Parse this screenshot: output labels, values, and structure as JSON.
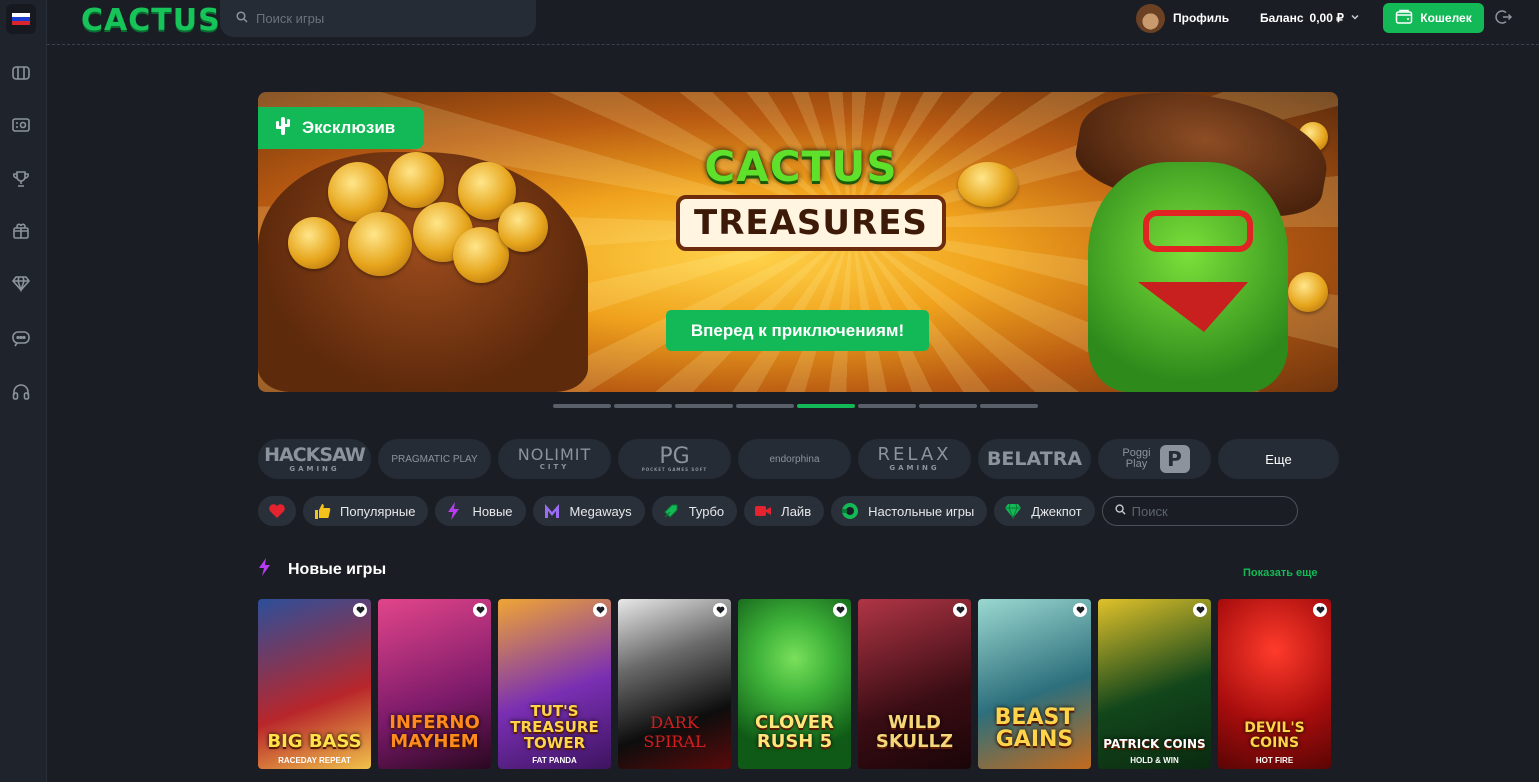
{
  "header": {
    "logo": "CACTUS",
    "search_placeholder": "Поиск игры",
    "profile_label": "Профиль",
    "balance_label": "Баланс",
    "balance_value": "0,00 ₽",
    "wallet_label": "Кошелек"
  },
  "sidebar": {
    "language": "ru",
    "items": [
      "slots-icon",
      "live-games-icon",
      "tournaments-icon",
      "gift-icon",
      "vip-diamond-icon",
      "chat-icon",
      "support-headset-icon"
    ]
  },
  "banner": {
    "badge": "Эксклюзив",
    "game_title_line1": "CACTUS",
    "game_title_line2": "TREASURES",
    "cta": "Вперед к приключениям!",
    "slides_total": 8,
    "active_slide": 5
  },
  "providers": [
    {
      "name": "HACKSAW",
      "sub": "GAMING"
    },
    {
      "name": "PRAGMATIC PLAY",
      "sub": ""
    },
    {
      "name": "NOLIMIT",
      "sub": "CITY"
    },
    {
      "name": "PG",
      "sub": "POCKET GAMES SOFT"
    },
    {
      "name": "endorphina",
      "sub": ""
    },
    {
      "name": "RELAX",
      "sub": "GAMING"
    },
    {
      "name": "BELATRA",
      "sub": ""
    },
    {
      "name": "Poggi Play",
      "sub": ""
    }
  ],
  "providers_more": "Еще",
  "categories": [
    {
      "label": "",
      "icon": "heart-icon",
      "color": "#e5232f"
    },
    {
      "label": "Популярные",
      "icon": "thumbs-up-icon",
      "color": "#f3c21b"
    },
    {
      "label": "Новые",
      "icon": "lightning-icon",
      "color": "#b83cf0"
    },
    {
      "label": "Megaways",
      "icon": "megaways-icon",
      "color": "#9a6cf5"
    },
    {
      "label": "Турбо",
      "icon": "turbo-icon",
      "color": "#14b957"
    },
    {
      "label": "Лайв",
      "icon": "live-camera-icon",
      "color": "#e5232f"
    },
    {
      "label": "Настольные игры",
      "icon": "table-games-icon",
      "color": "#14b957"
    },
    {
      "label": "Джекпот",
      "icon": "diamond-icon",
      "color": "#14b957"
    }
  ],
  "category_search_placeholder": "Поиск",
  "new_games": {
    "title": "Новые игры",
    "show_more": "Показать еще",
    "games": [
      {
        "name": "BIG BASS",
        "sub": "RACEDAY REPEAT",
        "bg": "#b8262b",
        "bg2": "#2c4f9a"
      },
      {
        "name": "INFERNO MAYHEM",
        "sub": "",
        "bg": "#7b1a6a",
        "bg2": "#e2458a"
      },
      {
        "name": "TUT'S TREASURE TOWER",
        "sub": "FAT PANDA",
        "bg": "#7a2fb3",
        "bg2": "#f0a534"
      },
      {
        "name": "DARK SPIRAL",
        "sub": "",
        "bg": "#0d0d0d",
        "bg2": "#6a6a6a"
      },
      {
        "name": "CLOVER RUSH 5",
        "sub": "",
        "bg": "#0f5a16",
        "bg2": "#3fb43a"
      },
      {
        "name": "WILD SKULLZ",
        "sub": "",
        "bg": "#3a0d14",
        "bg2": "#b03545"
      },
      {
        "name": "BEAST GAINS",
        "sub": "",
        "bg": "#2d6f7c",
        "bg2": "#9ad8d0"
      },
      {
        "name": "PATRICK COINS",
        "sub": "HOLD & WIN",
        "bg": "#12461b",
        "bg2": "#e0c12a"
      },
      {
        "name": "DEVIL'S COINS",
        "sub": "HOT FIRE",
        "bg": "#a80d0d",
        "bg2": "#ff3b2b"
      }
    ]
  },
  "colors": {
    "accent": "#14b957",
    "background": "#1a1e24",
    "panel": "#262c35"
  }
}
